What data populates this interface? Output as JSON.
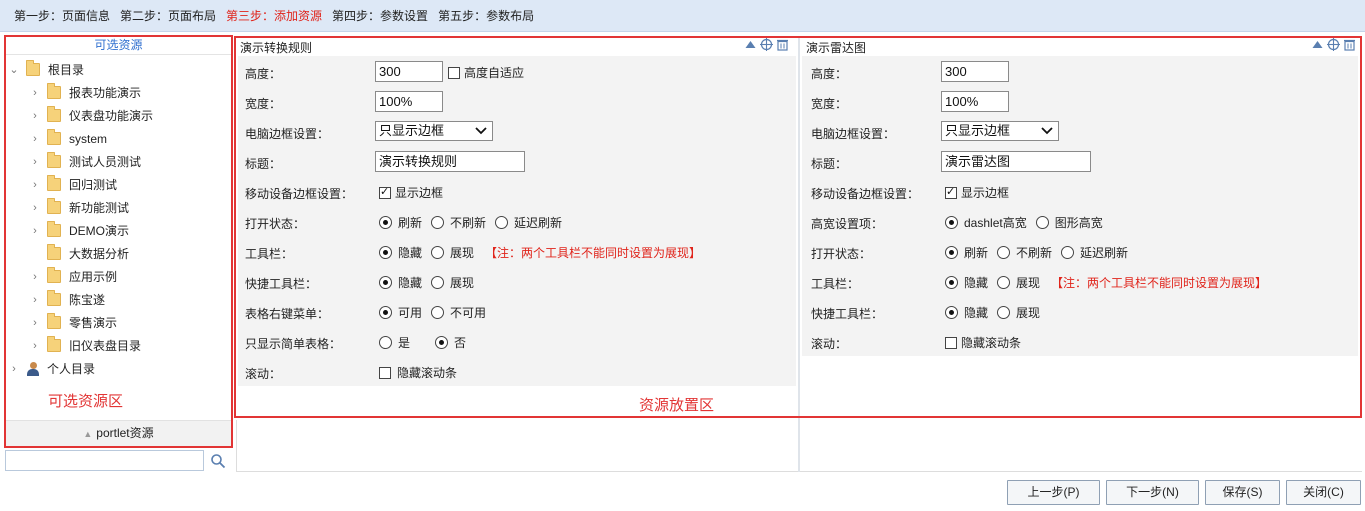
{
  "steps": [
    "第一步：页面信息",
    "第二步：页面布局",
    "第三步：添加资源",
    "第四步：参数设置",
    "第五步：参数布局"
  ],
  "active_step": 2,
  "left_panel": {
    "title": "可选资源",
    "root": "根目录",
    "children": [
      "报表功能演示",
      "仪表盘功能演示",
      "system",
      "测试人员测试",
      "回归测试",
      "新功能测试",
      "DEMO演示",
      "大数据分析",
      "应用示例",
      "陈宝遂",
      "零售演示",
      "旧仪表盘目录"
    ],
    "personal": "个人目录",
    "area_label": "可选资源区",
    "portlet_label": "portlet资源",
    "search_placeholder": ""
  },
  "zone_label": "资源放置区",
  "panel1": {
    "title": "演示转换规则",
    "height_label": "高度：",
    "height_value": "300",
    "auto_height": "高度自适应",
    "width_label": "宽度：",
    "width_value": "100%",
    "border_label": "电脑边框设置：",
    "border_value": "只显示边框",
    "title_label": "标题：",
    "title_value": "演示转换规则",
    "mobile_label": "移动设备边框设置：",
    "mobile_value": "显示边框",
    "open_label": "打开状态：",
    "open_opts": [
      "刷新",
      "不刷新",
      "延迟刷新"
    ],
    "toolbar_label": "工具栏：",
    "toolbar_opts": [
      "隐藏",
      "展现"
    ],
    "note": "【注：两个工具栏不能同时设置为展现】",
    "quick_label": "快捷工具栏：",
    "quick_opts": [
      "隐藏",
      "展现"
    ],
    "rightmenu_label": "表格右键菜单：",
    "rightmenu_opts": [
      "可用",
      "不可用"
    ],
    "simple_label": "只显示简单表格：",
    "simple_opts": [
      "是",
      "否"
    ],
    "scroll_label": "滚动：",
    "scroll_value": "隐藏滚动条"
  },
  "panel2": {
    "title": "演示雷达图",
    "height_label": "高度：",
    "height_value": "300",
    "width_label": "宽度：",
    "width_value": "100%",
    "border_label": "电脑边框设置：",
    "border_value": "只显示边框",
    "title_label": "标题：",
    "title_value": "演示雷达图",
    "mobile_label": "移动设备边框设置：",
    "mobile_value": "显示边框",
    "hw_label": "高宽设置项：",
    "hw_opts": [
      "dashlet高宽",
      "图形高宽"
    ],
    "open_label": "打开状态：",
    "open_opts": [
      "刷新",
      "不刷新",
      "延迟刷新"
    ],
    "toolbar_label": "工具栏：",
    "toolbar_opts": [
      "隐藏",
      "展现"
    ],
    "note": "【注：两个工具栏不能同时设置为展现】",
    "quick_label": "快捷工具栏：",
    "quick_opts": [
      "隐藏",
      "展现"
    ],
    "scroll_label": "滚动：",
    "scroll_value": "隐藏滚动条"
  },
  "buttons": {
    "prev": "上一步(P)",
    "next": "下一步(N)",
    "save": "保存(S)",
    "close": "关闭(C)"
  },
  "colors": {
    "accent": "#e23535",
    "link": "#2f6fcf",
    "header_bg": "#dde8f6"
  }
}
